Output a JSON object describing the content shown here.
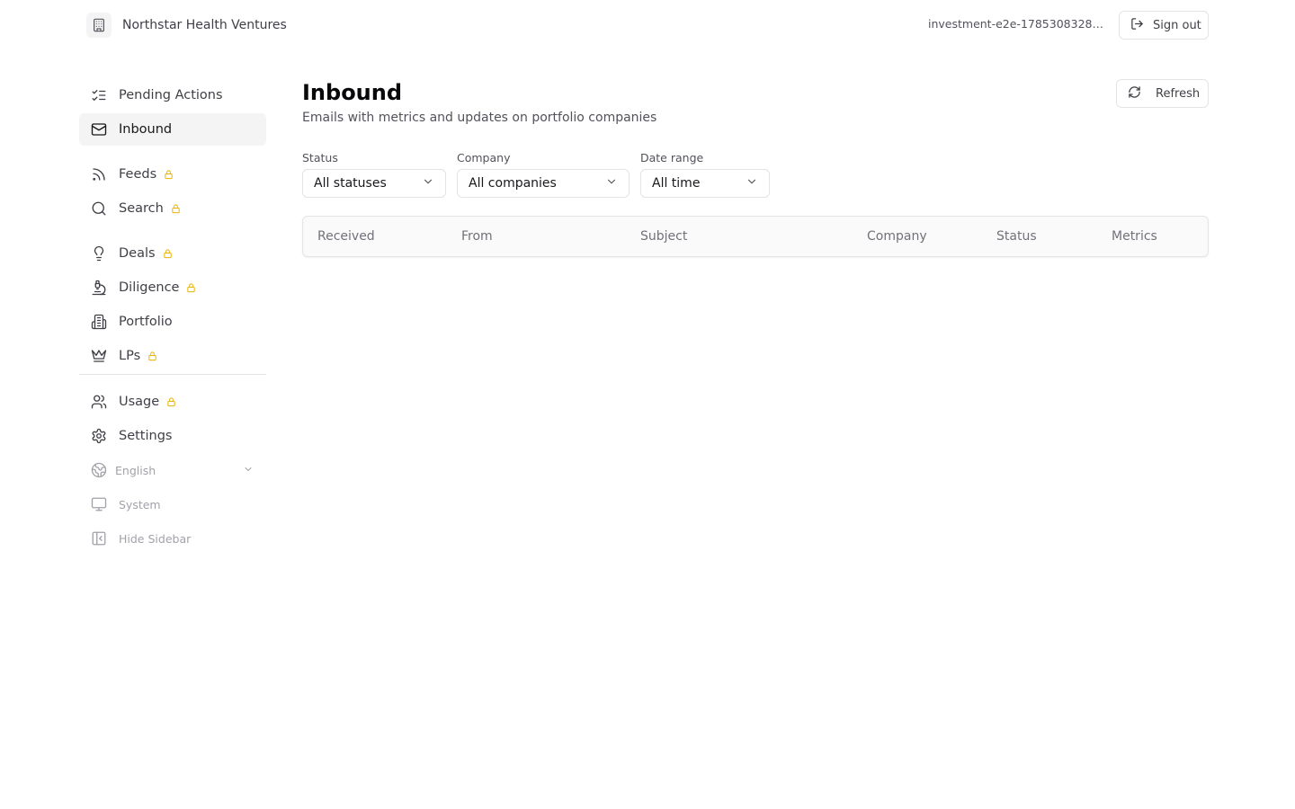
{
  "header": {
    "org_name": "Northstar Health Ventures",
    "user_id": "investment-e2e-17853083287...",
    "sign_out_label": "Sign out"
  },
  "sidebar": {
    "items": [
      {
        "label": "Pending Actions",
        "icon": "list-checks-icon",
        "locked": false,
        "active": false
      },
      {
        "label": "Inbound",
        "icon": "mail-icon",
        "locked": false,
        "active": true
      },
      {
        "label": "Feeds",
        "icon": "rss-icon",
        "locked": true
      },
      {
        "label": "Search",
        "icon": "search-icon",
        "locked": true
      },
      {
        "label": "Deals",
        "icon": "lightbulb-icon",
        "locked": true
      },
      {
        "label": "Diligence",
        "icon": "microscope-icon",
        "locked": true
      },
      {
        "label": "Portfolio",
        "icon": "building-icon",
        "locked": false
      },
      {
        "label": "LPs",
        "icon": "crown-icon",
        "locked": true
      },
      {
        "label": "Usage",
        "icon": "users-icon",
        "locked": true
      },
      {
        "label": "Settings",
        "icon": "gear-icon",
        "locked": false
      }
    ],
    "language": "English",
    "theme": "System",
    "hide_sidebar": "Hide Sidebar",
    "lock_color": "#eab308"
  },
  "main": {
    "title": "Inbound",
    "subtitle": "Emails with metrics and updates on portfolio companies",
    "refresh_label": "Refresh",
    "filters": {
      "status": {
        "label": "Status",
        "value": "All statuses"
      },
      "company": {
        "label": "Company",
        "value": "All companies"
      },
      "date_range": {
        "label": "Date range",
        "value": "All time"
      }
    },
    "table": {
      "columns": [
        "Received",
        "From",
        "Subject",
        "Company",
        "Status",
        "Metrics"
      ]
    }
  }
}
